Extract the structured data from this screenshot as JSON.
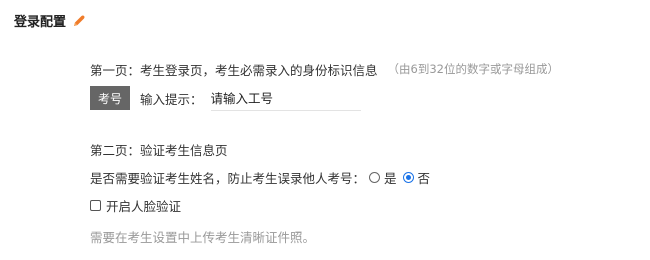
{
  "header": {
    "title": "登录配置",
    "icon": "edit-icon",
    "icon_color": "#f07c2a"
  },
  "page1": {
    "label": "第一页：考生登录页，考生必需录入的身份标识信息",
    "hint": "（由6到32位的数字或字母组成）"
  },
  "id_field": {
    "badge": "考号",
    "input_hint_label": "输入提示：",
    "input_value": "请输入工号"
  },
  "page2": {
    "label": "第二页：验证考生信息页"
  },
  "verify_name": {
    "question": "是否需要验证考生姓名，防止考生误录他人考号：",
    "options": [
      "是",
      "否"
    ],
    "selected": "否",
    "accent_color": "#1a73e8"
  },
  "face_verify": {
    "label": "开启人脸验证",
    "checked": false
  },
  "note": {
    "text": "需要在考生设置中上传考生清晰证件照。"
  }
}
